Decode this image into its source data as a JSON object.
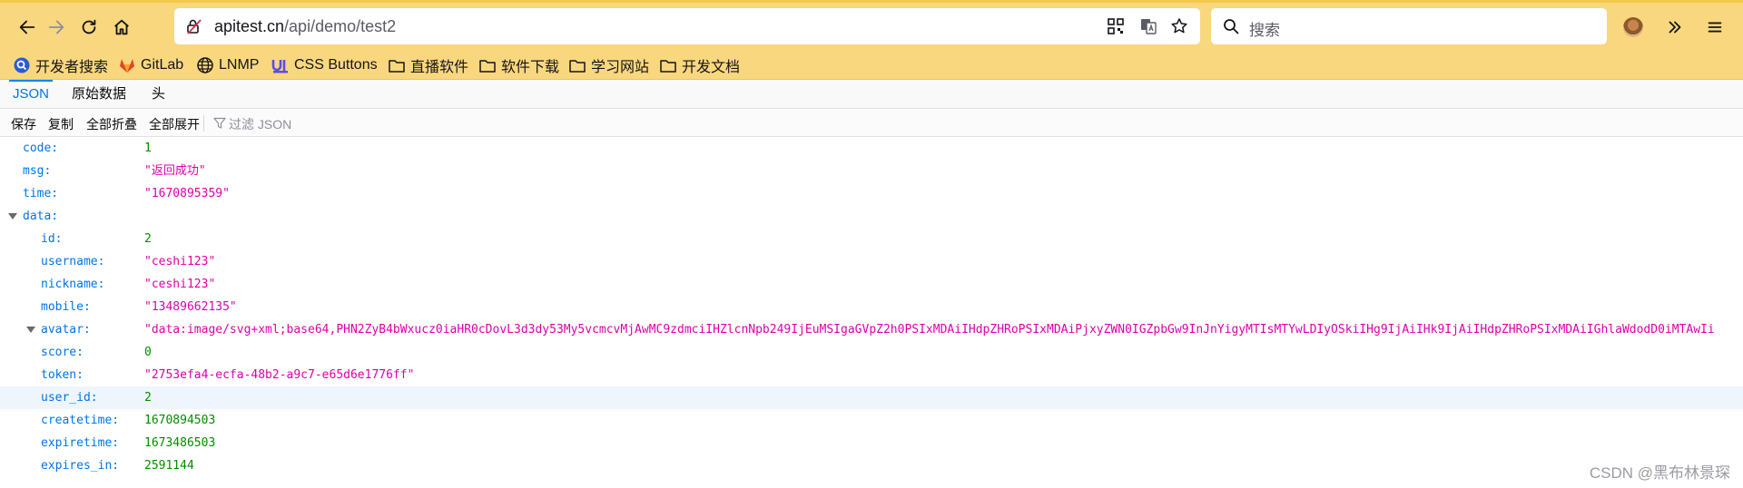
{
  "browser": {
    "url_host": "apitest.cn",
    "url_path": "/api/demo/test2",
    "search_placeholder": "搜索"
  },
  "bookmarks": [
    {
      "label": "开发者搜索",
      "icon": "developer-search-icon"
    },
    {
      "label": "GitLab",
      "icon": "gitlab-icon"
    },
    {
      "label": "LNMP",
      "icon": "globe-icon"
    },
    {
      "label": "CSS Buttons",
      "icon": "ui-icon"
    },
    {
      "label": "直播软件",
      "icon": "folder-icon"
    },
    {
      "label": "软件下载",
      "icon": "folder-icon"
    },
    {
      "label": "学习网站",
      "icon": "folder-icon"
    },
    {
      "label": "开发文档",
      "icon": "folder-icon"
    }
  ],
  "viewer": {
    "tabs": [
      "JSON",
      "原始数据",
      "头"
    ],
    "active_tab": "JSON",
    "toolbar": {
      "save": "保存",
      "copy": "复制",
      "collapse_all": "全部折叠",
      "expand_all": "全部展开",
      "filter_placeholder": "过滤 JSON"
    }
  },
  "json_rows": [
    {
      "key": "code:",
      "value": "1",
      "type": "num",
      "indent": 0
    },
    {
      "key": "msg:",
      "value": "\"返回成功\"",
      "type": "str",
      "indent": 0
    },
    {
      "key": "time:",
      "value": "\"1670895359\"",
      "type": "str",
      "indent": 0
    },
    {
      "key": "data:",
      "value": "",
      "type": "obj",
      "indent": 0,
      "expanded": true
    },
    {
      "key": "id:",
      "value": "2",
      "type": "num",
      "indent": 1
    },
    {
      "key": "username:",
      "value": "\"ceshi123\"",
      "type": "str",
      "indent": 1
    },
    {
      "key": "nickname:",
      "value": "\"ceshi123\"",
      "type": "str",
      "indent": 1
    },
    {
      "key": "mobile:",
      "value": "\"13489662135\"",
      "type": "str",
      "indent": 1
    },
    {
      "key": "avatar:",
      "value": "\"data:image/svg+xml;base64,PHN2ZyB4bWxucz0iaHR0cDovL3d3dy53My5vcmcvMjAwMC9zdmciIHZlcnNpb249IjEuMSIgaGVpZ2h0PSIxMDAiIHdpZHRoPSIxMDAiPjxyZWN0IGZpbGw9InJnYigyMTIsMTYwLDIyOSkiIHg9IjAiIHk9IjAiIHdpZHRoPSIxMDAiIGhlaWdodD0iMTAwIi",
      "type": "str",
      "indent": 1,
      "expanded": true
    },
    {
      "key": "score:",
      "value": "0",
      "type": "num",
      "indent": 1
    },
    {
      "key": "token:",
      "value": "\"2753efa4-ecfa-48b2-a9c7-e65d6e1776ff\"",
      "type": "str",
      "indent": 1
    },
    {
      "key": "user_id:",
      "value": "2",
      "type": "num",
      "indent": 1,
      "highlighted": true
    },
    {
      "key": "createtime:",
      "value": "1670894503",
      "type": "num",
      "indent": 1
    },
    {
      "key": "expiretime:",
      "value": "1673486503",
      "type": "num",
      "indent": 1
    },
    {
      "key": "expires_in:",
      "value": "2591144",
      "type": "num",
      "indent": 1
    }
  ],
  "watermark": "CSDN @黑布林景琛",
  "colors": {
    "chrome_yellow": "#f9d77e",
    "key_blue": "#0074e8",
    "number_green": "#058b00",
    "string_magenta": "#dd00a9"
  }
}
